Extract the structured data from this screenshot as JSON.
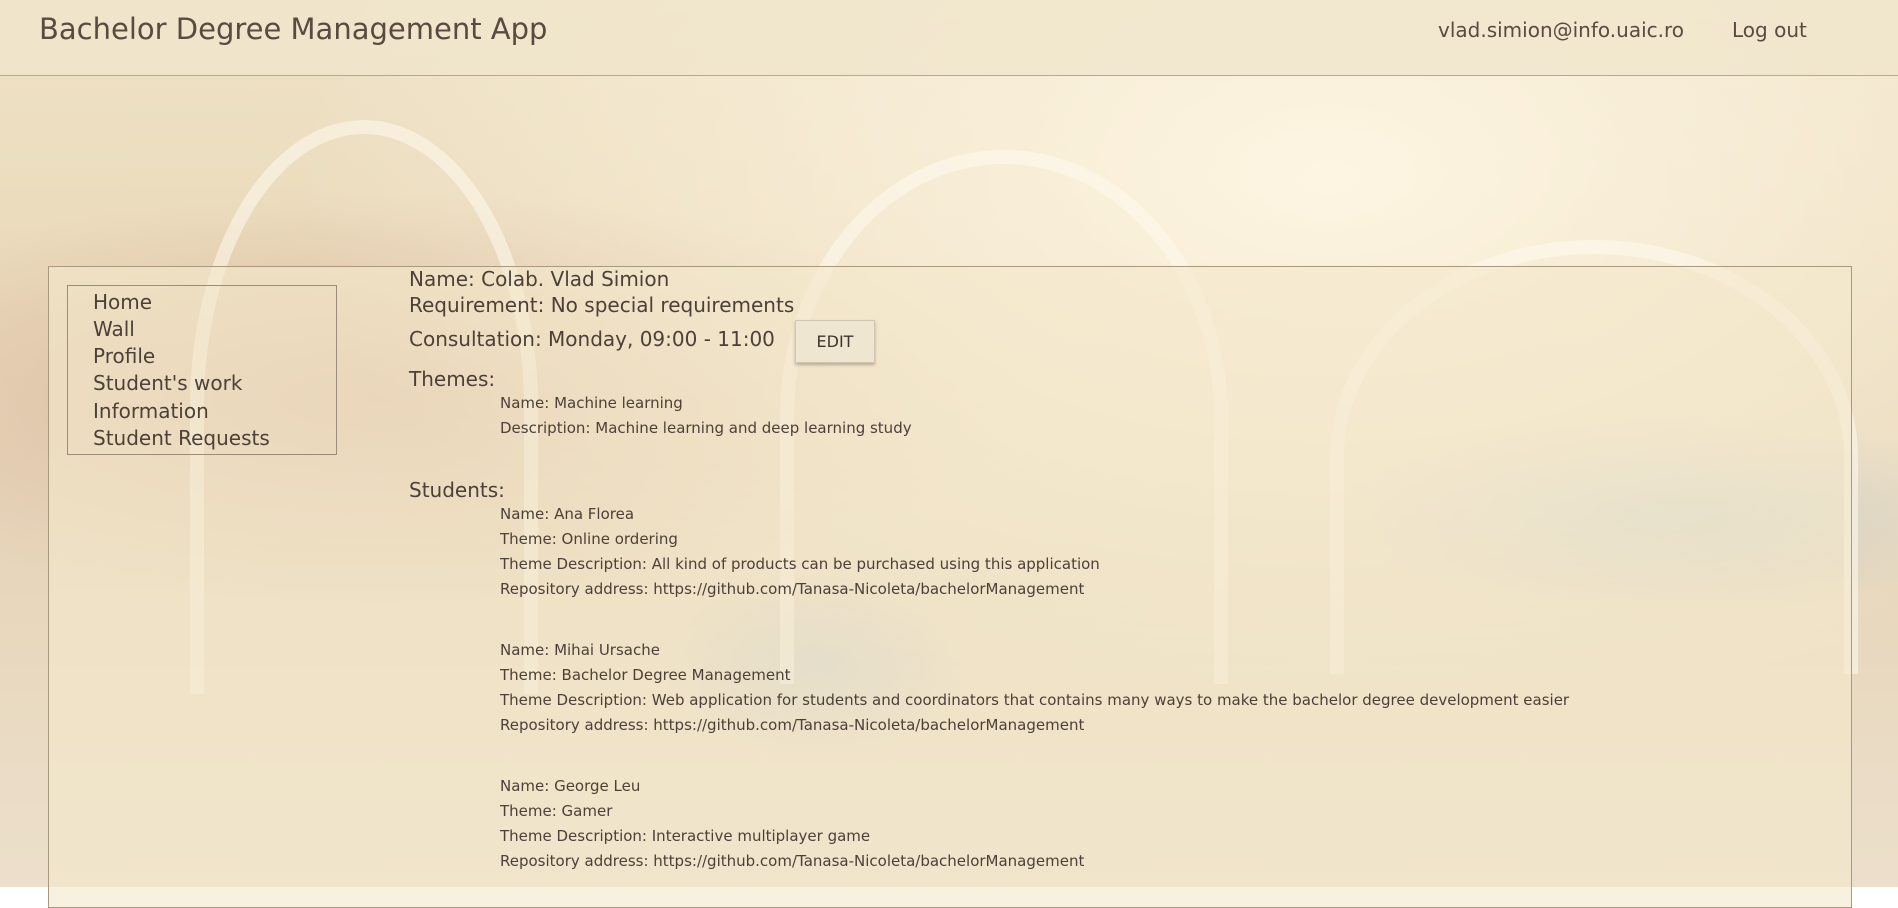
{
  "header": {
    "title": "Bachelor Degree Management App",
    "user_email": "vlad.simion@info.uaic.ro",
    "logout_label": "Log out"
  },
  "sidebar": {
    "items": [
      {
        "label": "Home"
      },
      {
        "label": "Wall"
      },
      {
        "label": "Profile"
      },
      {
        "label": "Student's work"
      },
      {
        "label": "Information"
      },
      {
        "label": "Student Requests"
      }
    ]
  },
  "profile": {
    "name_line": "Name: Colab. Vlad Simion",
    "requirement_line": "Requirement: No special requirements",
    "consultation_line": "Consultation: Monday, 09:00 - 11:00",
    "edit_label": "EDIT",
    "themes_heading": "Themes:",
    "themes": [
      {
        "name": "Name: Machine learning",
        "description": "Description: Machine learning and deep learning study"
      }
    ],
    "students_heading": "Students:",
    "students": [
      {
        "name": "Name: Ana Florea",
        "theme": "Theme: Online ordering",
        "description": "Theme Description: All kind of products can be purchased using this application",
        "repo": "Repository address: https://github.com/Tanasa-Nicoleta/bachelorManagement"
      },
      {
        "name": "Name: Mihai Ursache",
        "theme": "Theme: Bachelor Degree Management",
        "description": "Theme Description: Web application for students and coordinators that contains many ways to make the bachelor degree development easier",
        "repo": "Repository address: https://github.com/Tanasa-Nicoleta/bachelorManagement"
      },
      {
        "name": "Name: George Leu",
        "theme": "Theme: Gamer",
        "description": "Theme Description: Interactive multiplayer game",
        "repo": "Repository address: https://github.com/Tanasa-Nicoleta/bachelorManagement"
      }
    ]
  }
}
